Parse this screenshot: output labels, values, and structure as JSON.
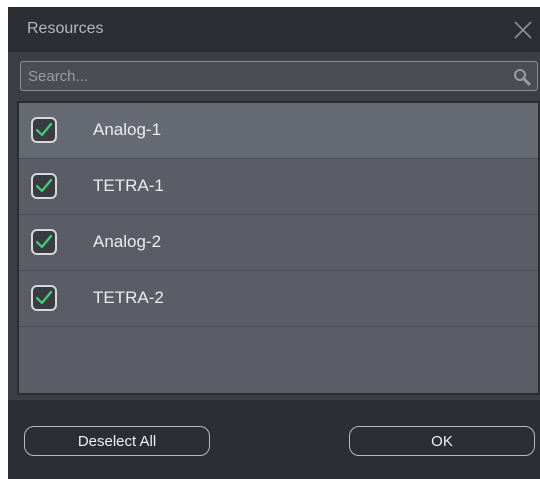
{
  "dialog": {
    "title": "Resources",
    "close_icon": "close-icon"
  },
  "search": {
    "placeholder": "Search...",
    "value": "",
    "icon": "search-icon"
  },
  "resources": {
    "items": [
      {
        "label": "Analog-1",
        "checked": true,
        "selected": true
      },
      {
        "label": "TETRA-1",
        "checked": true,
        "selected": false
      },
      {
        "label": "Analog-2",
        "checked": true,
        "selected": false
      },
      {
        "label": "TETRA-2",
        "checked": true,
        "selected": false
      }
    ]
  },
  "footer": {
    "deselect_all_label": "Deselect All",
    "ok_label": "OK"
  },
  "colors": {
    "checkmark": "#3fd07a"
  }
}
